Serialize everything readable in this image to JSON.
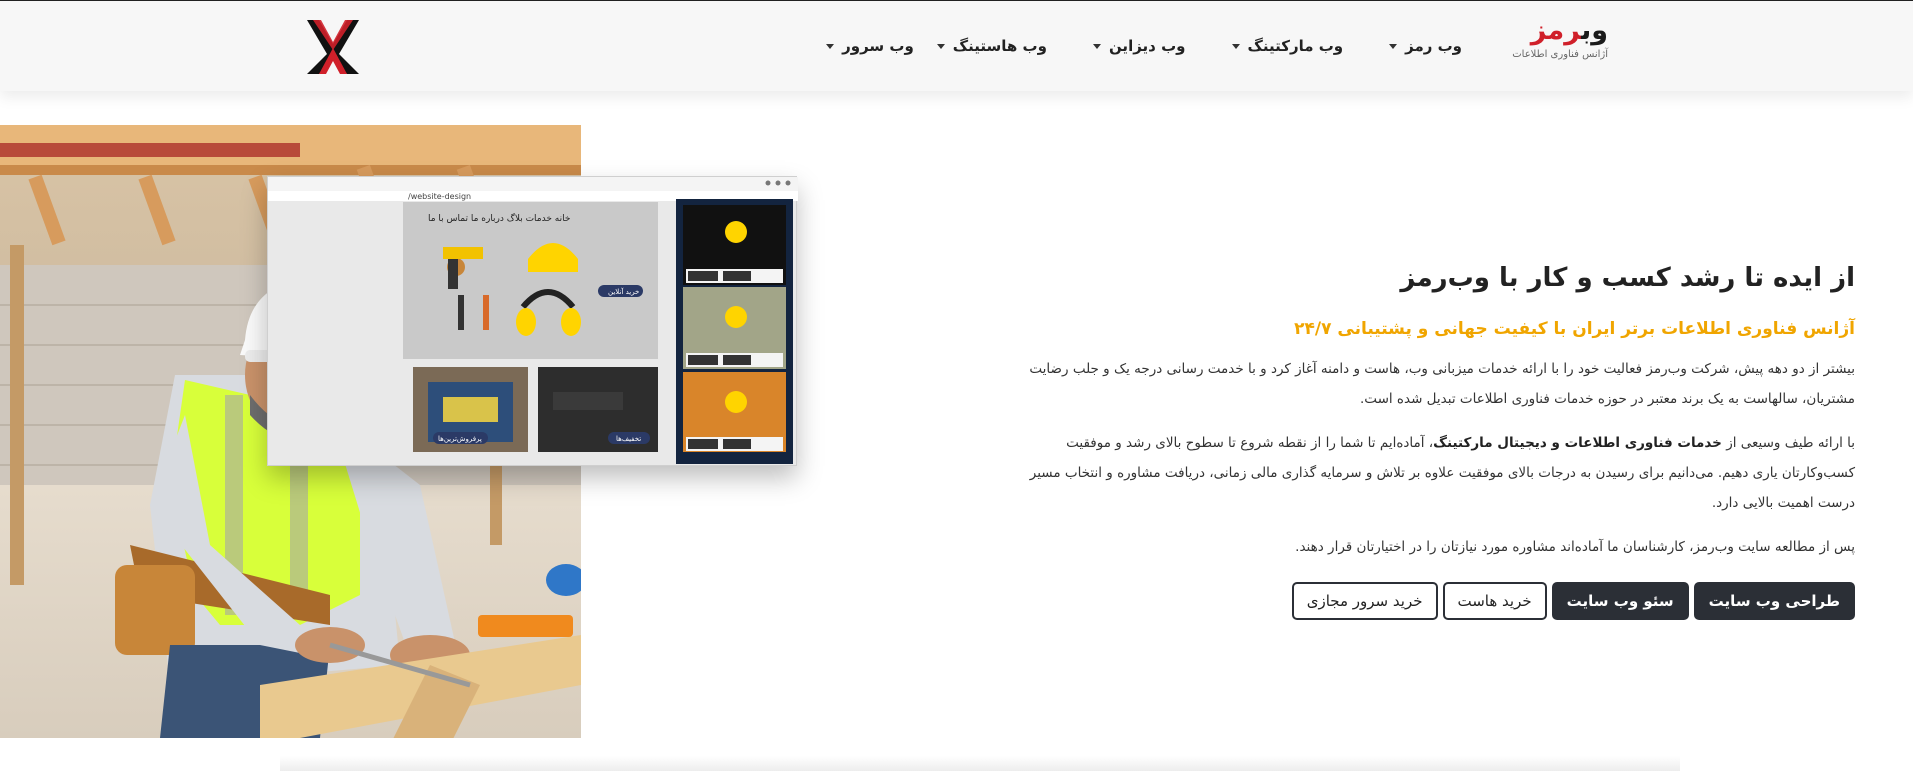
{
  "header": {
    "brand_name_part1": "وب",
    "brand_name_part2": "رمز",
    "brand_tagline": "آژانس فناوری اطلاعات",
    "nav": [
      {
        "label": "وب سرور"
      },
      {
        "label": "وب هاستینگ"
      },
      {
        "label": "وب دیزاین"
      },
      {
        "label": "وب مارکتینگ"
      },
      {
        "label": "وب رمز"
      }
    ]
  },
  "hero": {
    "title": "از ایده تا رشد کسب و کار با وب‌رمز",
    "subtitle": "آژانس فناوری اطلاعات برتر ایران با کیفیت جهانی و پشتیبانی ۲۴/۷",
    "para1": "بیشتر از دو دهه پیش، شرکت وب‌رمز فعالیت خود را با ارائه خدمات میزبانی وب، هاست و دامنه آغاز کرد و با خدمت رسانی درجه یک و جلب رضایت مشتریان، سالهاست به یک برند معتبر در حوزه خدمات فناوری اطلاعات تبدیل شده است.",
    "para2_pre": "با ارائه طیف وسیعی از ",
    "para2_bold": "خدمات فناوری اطلاعات و دیجیتال مارکتینگ",
    "para2_post": "، آماده‌ایم تا شما را از نقطه شروع تا سطوح بالای رشد و موفقیت کسب‌وکارتان یاری دهیم. می‌دانیم برای رسیدن به درجات بالای موفقیت علاوه بر تلاش و سرمایه گذاری مالی زمانی، دریافت مشاوره و انتخاب مسیر درست اهمیت بالایی دارد.",
    "para3": "پس از مطالعه سایت وب‌رمز، کارشناسان ما آماده‌اند مشاوره مورد نیازتان را در اختیارتان قرار دهند.",
    "buttons": {
      "web_design": "طراحی وب سایت",
      "seo": "سئو وب سایت",
      "hosting": "خرید هاست",
      "vps": "خرید سرور مجازی"
    }
  },
  "mockup": {
    "url": "/website-design",
    "nav_links": "خانه  خدمات  بلاگ  درباره ما  تماس با ما",
    "cta_buy": "خرید آنلاین",
    "cta_discount": "تخفیف‌ها",
    "cta_more": "پرفروش‌ترین‌ها"
  },
  "colors": {
    "accent": "#f0a500",
    "brand_red": "#d0202a",
    "button_dark": "#2b2f36"
  }
}
